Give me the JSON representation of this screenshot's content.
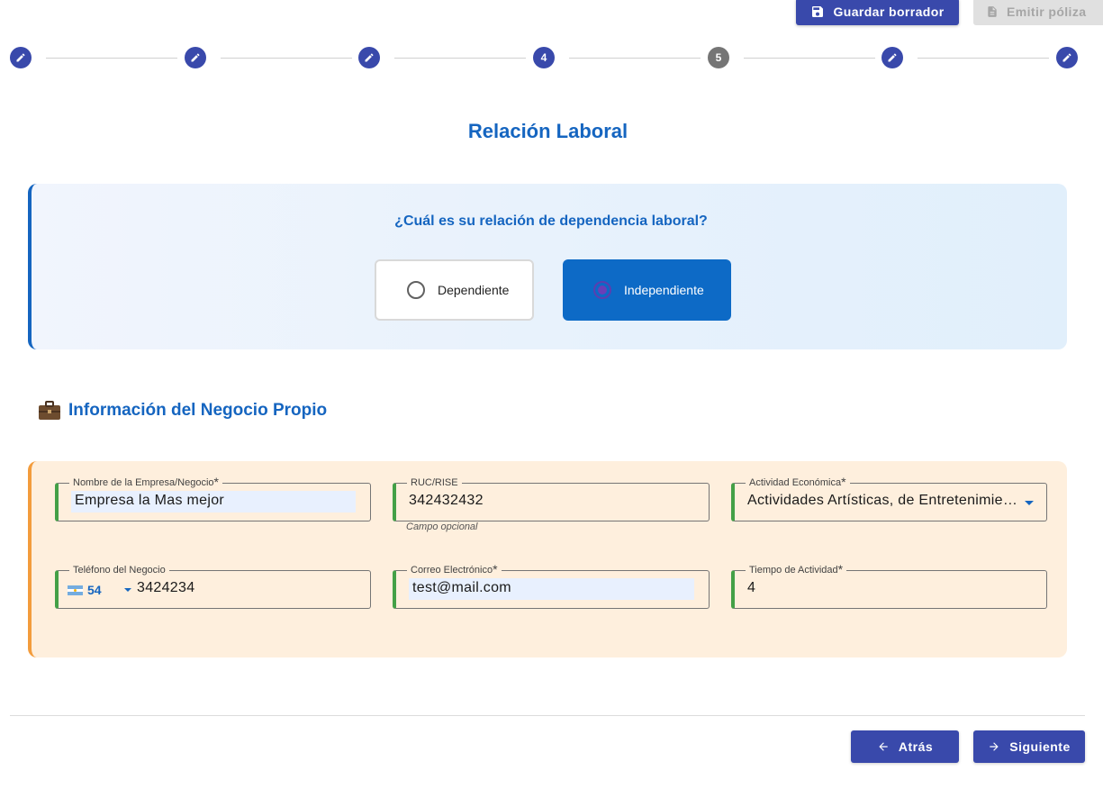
{
  "toolbar": {
    "save_label": "Guardar borrador",
    "emit_label": "Emitir póliza"
  },
  "stepper": {
    "steps": [
      {
        "state": "done",
        "label": ""
      },
      {
        "state": "done",
        "label": ""
      },
      {
        "state": "done",
        "label": ""
      },
      {
        "state": "numbered",
        "label": "4"
      },
      {
        "state": "current",
        "label": "5"
      },
      {
        "state": "done",
        "label": ""
      },
      {
        "state": "done",
        "label": ""
      }
    ]
  },
  "page": {
    "title": "Relación Laboral"
  },
  "relation": {
    "question": "¿Cuál es su relación de dependencia laboral?",
    "options": [
      {
        "label": "Dependiente",
        "selected": false
      },
      {
        "label": "Independiente",
        "selected": true
      }
    ]
  },
  "business": {
    "section_title": "Información del Negocio Propio",
    "company_name": {
      "label": "Nombre de la Empresa/Negocio",
      "required": "*",
      "value": "Empresa la Mas mejor"
    },
    "ruc": {
      "label": "RUC/RISE",
      "value": "342432432",
      "helper": "Campo opcional"
    },
    "activity": {
      "label": "Actividad Económica",
      "required": "*",
      "value": "Actividades Artísticas, de Entretenimie…"
    },
    "phone": {
      "label": "Teléfono del Negocio",
      "prefix": "54",
      "value": "3424234"
    },
    "email": {
      "label": "Correo Electrónico",
      "required": "*",
      "value": "test@mail.com"
    },
    "time": {
      "label": "Tiempo de Actividad",
      "required": "*",
      "value": "4"
    }
  },
  "nav": {
    "back_label": "Atrás",
    "next_label": "Siguiente"
  },
  "colors": {
    "primary": "#3949ab",
    "accent_blue": "#1565c0",
    "selected_option": "#0d6ac6",
    "business_bg": "#feefdd",
    "business_border": "#f39c3c",
    "field_valid": "#43a047"
  }
}
